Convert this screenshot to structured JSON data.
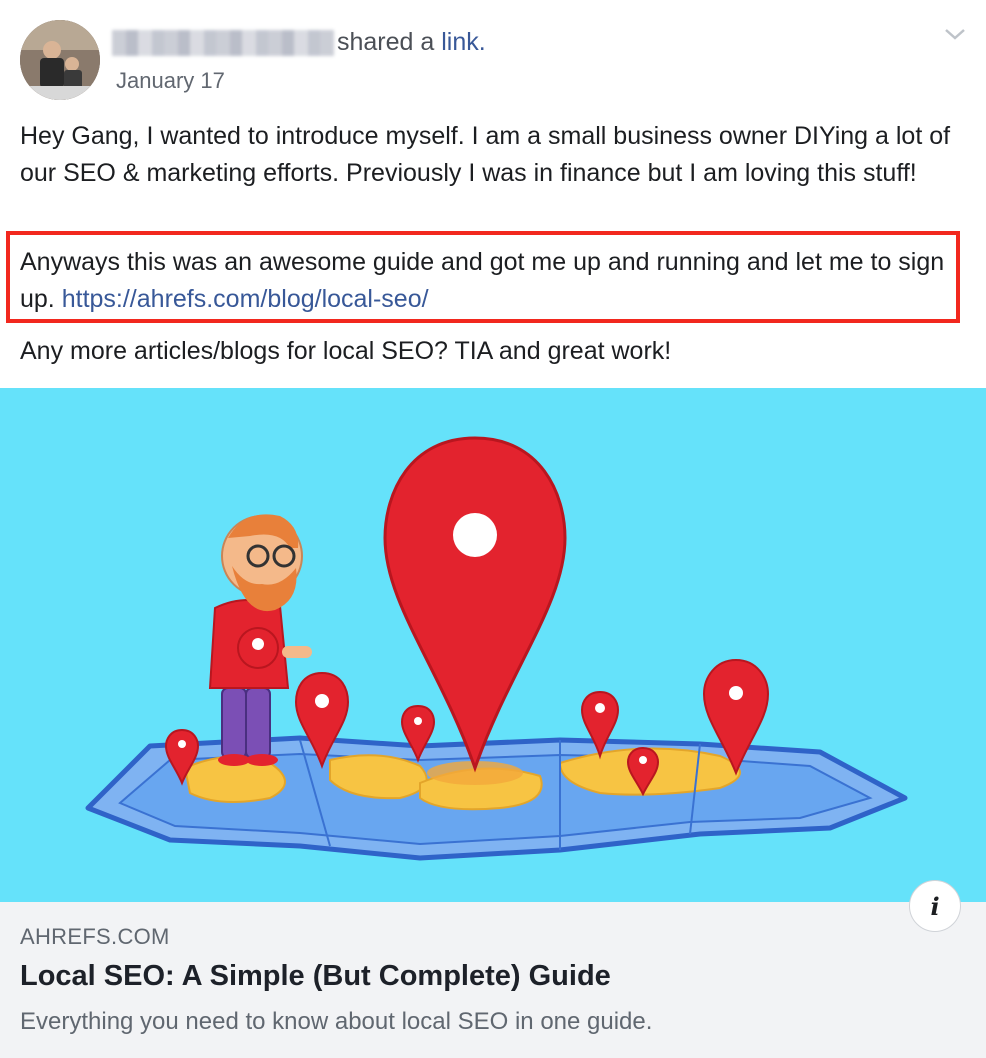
{
  "post": {
    "headline_prefix": "shared a",
    "headline_link": "link.",
    "date": "January 17",
    "paragraphs": {
      "p1": "Hey Gang, I wanted to introduce myself. I am a small business owner DIYing a lot of our SEO & marketing efforts. Previously I was in finance but I am loving this stuff!",
      "p2_text": "Anyways this was an awesome guide and got me up and running and let me to sign up.",
      "p2_url": "https://ahrefs.com/blog/local-seo/",
      "p3": "Any more articles/blogs for local SEO? TIA and great work!"
    }
  },
  "link_preview": {
    "domain": "AHREFS.COM",
    "title": "Local SEO: A Simple (But Complete) Guide",
    "description": "Everything you need to know about local SEO in one guide.",
    "info_label": "i"
  },
  "colors": {
    "link": "#385898",
    "highlight_border": "#f2281e",
    "preview_bg": "#65e2fa",
    "pin_red": "#e3232e",
    "map_blue": "#4a8fe0",
    "land_yellow": "#f7c443"
  },
  "icons": [
    "chevron-down-icon",
    "info-icon",
    "avatar"
  ]
}
